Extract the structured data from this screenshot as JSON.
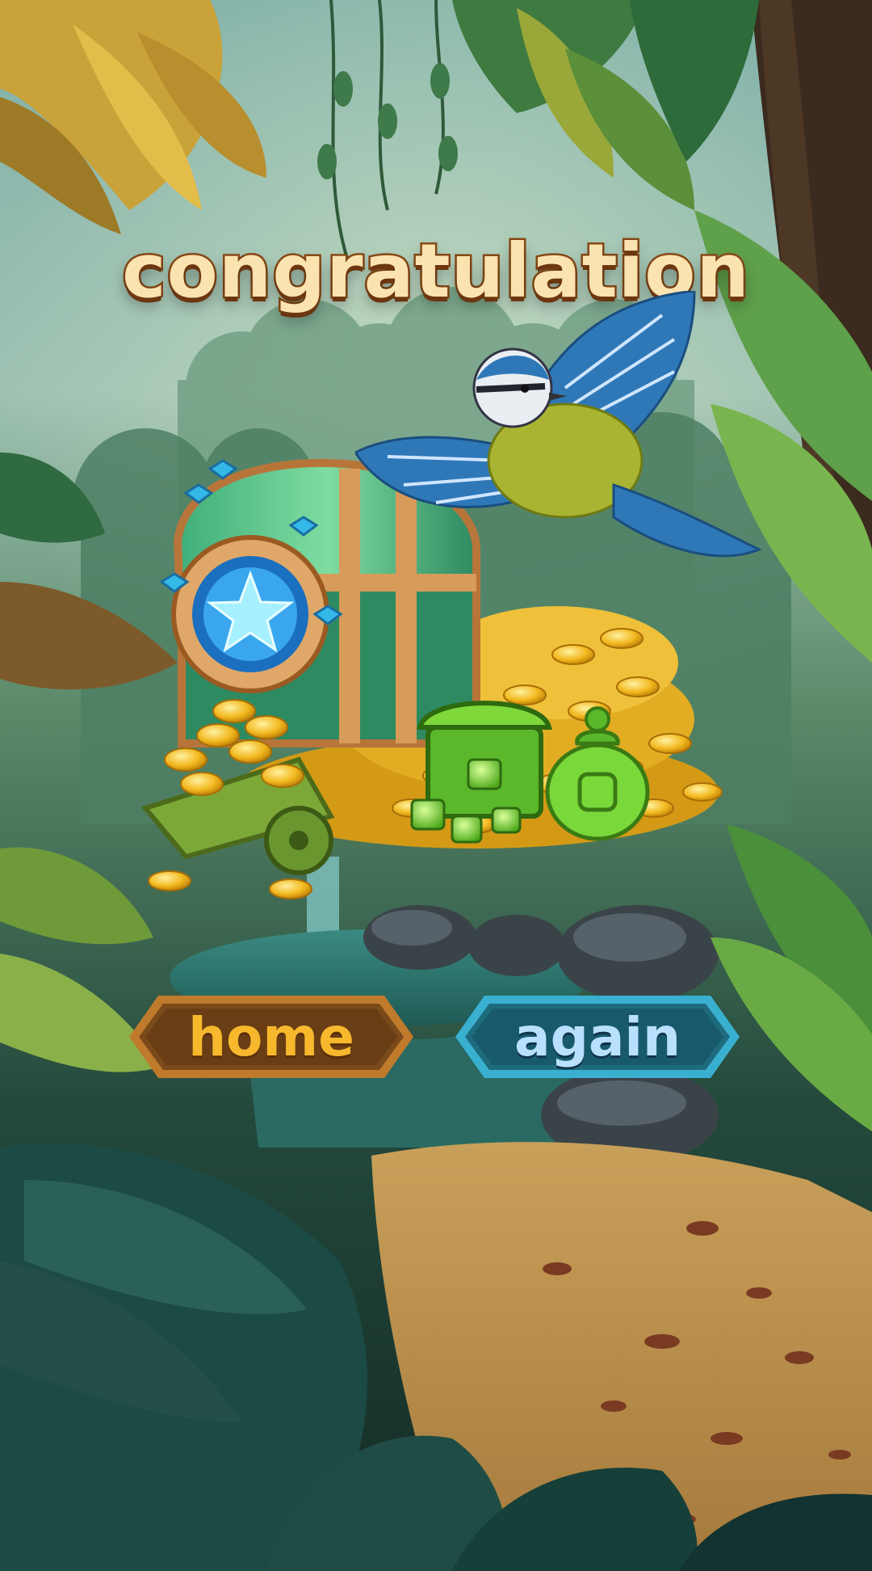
{
  "screen": {
    "title": "congratulation"
  },
  "buttons": {
    "home_label": "home",
    "again_label": "again"
  },
  "icons": {
    "reward_chest": "treasure-chest-icon",
    "bird": "blue-tit-bird-icon",
    "coins": "gold-coins-icon",
    "gem_chest": "gem-chest-icon",
    "money_bag": "money-bag-icon"
  },
  "colors": {
    "title_fill": "#fbe3b0",
    "title_stroke": "#8a4a16",
    "home_button": "#7a4a1a",
    "home_text": "#f7b82e",
    "again_button": "#1f6b7e",
    "again_text": "#b9e0ff"
  }
}
